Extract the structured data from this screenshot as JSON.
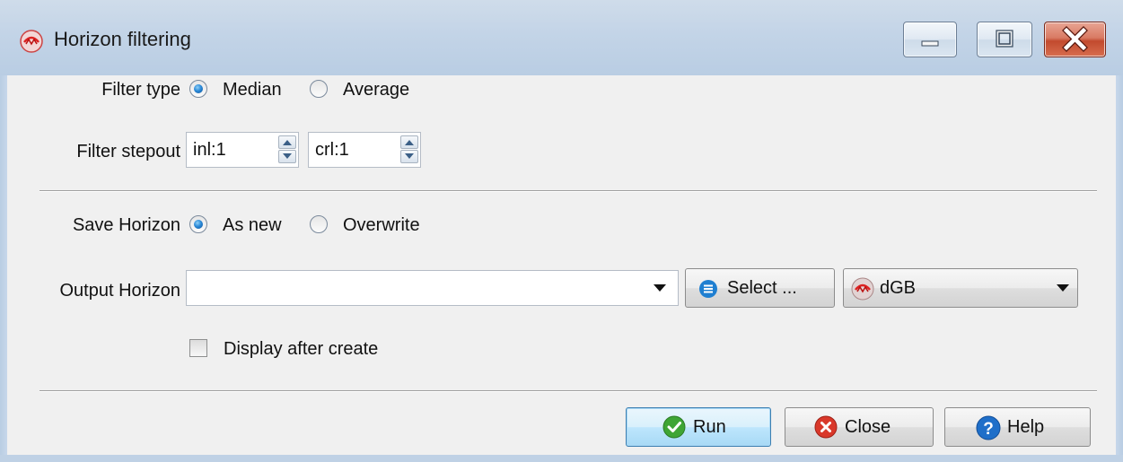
{
  "window": {
    "title": "Horizon filtering",
    "app_icon": "dgb-logo-icon",
    "controls": {
      "minimize": "minimize-icon",
      "maximize": "maximize-icon",
      "close": "close-icon"
    }
  },
  "filter_type": {
    "label": "Filter type",
    "options": [
      {
        "label": "Median",
        "checked": true
      },
      {
        "label": "Average",
        "checked": false
      }
    ]
  },
  "filter_stepout": {
    "label": "Filter stepout",
    "inline": "inl:1",
    "crossline": "crl:1"
  },
  "save_horizon": {
    "label": "Save Horizon",
    "options": [
      {
        "label": "As new",
        "checked": true
      },
      {
        "label": "Overwrite",
        "checked": false
      }
    ]
  },
  "output_horizon": {
    "label": "Output Horizon",
    "value": "",
    "select_label": "Select ...",
    "source_value": "dGB"
  },
  "display_after_create": {
    "label": "Display after create",
    "checked": false
  },
  "buttons": {
    "run": "Run",
    "close": "Close",
    "help": "Help"
  },
  "colors": {
    "accent": "#2b8ad8",
    "close_red": "#c24a2e",
    "run_green": "#3fa535"
  }
}
